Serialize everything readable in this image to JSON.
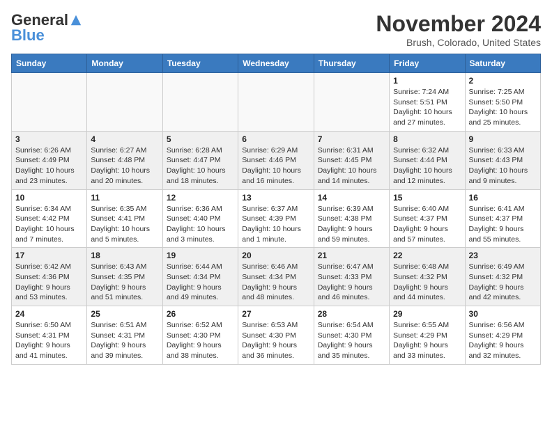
{
  "header": {
    "logo_general": "General",
    "logo_blue": "Blue",
    "month_title": "November 2024",
    "subtitle": "Brush, Colorado, United States"
  },
  "weekdays": [
    "Sunday",
    "Monday",
    "Tuesday",
    "Wednesday",
    "Thursday",
    "Friday",
    "Saturday"
  ],
  "weeks": [
    [
      {
        "day": "",
        "empty": true
      },
      {
        "day": "",
        "empty": true
      },
      {
        "day": "",
        "empty": true
      },
      {
        "day": "",
        "empty": true
      },
      {
        "day": "",
        "empty": true
      },
      {
        "day": "1",
        "sunrise": "Sunrise: 7:24 AM",
        "sunset": "Sunset: 5:51 PM",
        "daylight": "Daylight: 10 hours and 27 minutes."
      },
      {
        "day": "2",
        "sunrise": "Sunrise: 7:25 AM",
        "sunset": "Sunset: 5:50 PM",
        "daylight": "Daylight: 10 hours and 25 minutes."
      }
    ],
    [
      {
        "day": "3",
        "sunrise": "Sunrise: 6:26 AM",
        "sunset": "Sunset: 4:49 PM",
        "daylight": "Daylight: 10 hours and 23 minutes."
      },
      {
        "day": "4",
        "sunrise": "Sunrise: 6:27 AM",
        "sunset": "Sunset: 4:48 PM",
        "daylight": "Daylight: 10 hours and 20 minutes."
      },
      {
        "day": "5",
        "sunrise": "Sunrise: 6:28 AM",
        "sunset": "Sunset: 4:47 PM",
        "daylight": "Daylight: 10 hours and 18 minutes."
      },
      {
        "day": "6",
        "sunrise": "Sunrise: 6:29 AM",
        "sunset": "Sunset: 4:46 PM",
        "daylight": "Daylight: 10 hours and 16 minutes."
      },
      {
        "day": "7",
        "sunrise": "Sunrise: 6:31 AM",
        "sunset": "Sunset: 4:45 PM",
        "daylight": "Daylight: 10 hours and 14 minutes."
      },
      {
        "day": "8",
        "sunrise": "Sunrise: 6:32 AM",
        "sunset": "Sunset: 4:44 PM",
        "daylight": "Daylight: 10 hours and 12 minutes."
      },
      {
        "day": "9",
        "sunrise": "Sunrise: 6:33 AM",
        "sunset": "Sunset: 4:43 PM",
        "daylight": "Daylight: 10 hours and 9 minutes."
      }
    ],
    [
      {
        "day": "10",
        "sunrise": "Sunrise: 6:34 AM",
        "sunset": "Sunset: 4:42 PM",
        "daylight": "Daylight: 10 hours and 7 minutes."
      },
      {
        "day": "11",
        "sunrise": "Sunrise: 6:35 AM",
        "sunset": "Sunset: 4:41 PM",
        "daylight": "Daylight: 10 hours and 5 minutes."
      },
      {
        "day": "12",
        "sunrise": "Sunrise: 6:36 AM",
        "sunset": "Sunset: 4:40 PM",
        "daylight": "Daylight: 10 hours and 3 minutes."
      },
      {
        "day": "13",
        "sunrise": "Sunrise: 6:37 AM",
        "sunset": "Sunset: 4:39 PM",
        "daylight": "Daylight: 10 hours and 1 minute."
      },
      {
        "day": "14",
        "sunrise": "Sunrise: 6:39 AM",
        "sunset": "Sunset: 4:38 PM",
        "daylight": "Daylight: 9 hours and 59 minutes."
      },
      {
        "day": "15",
        "sunrise": "Sunrise: 6:40 AM",
        "sunset": "Sunset: 4:37 PM",
        "daylight": "Daylight: 9 hours and 57 minutes."
      },
      {
        "day": "16",
        "sunrise": "Sunrise: 6:41 AM",
        "sunset": "Sunset: 4:37 PM",
        "daylight": "Daylight: 9 hours and 55 minutes."
      }
    ],
    [
      {
        "day": "17",
        "sunrise": "Sunrise: 6:42 AM",
        "sunset": "Sunset: 4:36 PM",
        "daylight": "Daylight: 9 hours and 53 minutes."
      },
      {
        "day": "18",
        "sunrise": "Sunrise: 6:43 AM",
        "sunset": "Sunset: 4:35 PM",
        "daylight": "Daylight: 9 hours and 51 minutes."
      },
      {
        "day": "19",
        "sunrise": "Sunrise: 6:44 AM",
        "sunset": "Sunset: 4:34 PM",
        "daylight": "Daylight: 9 hours and 49 minutes."
      },
      {
        "day": "20",
        "sunrise": "Sunrise: 6:46 AM",
        "sunset": "Sunset: 4:34 PM",
        "daylight": "Daylight: 9 hours and 48 minutes."
      },
      {
        "day": "21",
        "sunrise": "Sunrise: 6:47 AM",
        "sunset": "Sunset: 4:33 PM",
        "daylight": "Daylight: 9 hours and 46 minutes."
      },
      {
        "day": "22",
        "sunrise": "Sunrise: 6:48 AM",
        "sunset": "Sunset: 4:32 PM",
        "daylight": "Daylight: 9 hours and 44 minutes."
      },
      {
        "day": "23",
        "sunrise": "Sunrise: 6:49 AM",
        "sunset": "Sunset: 4:32 PM",
        "daylight": "Daylight: 9 hours and 42 minutes."
      }
    ],
    [
      {
        "day": "24",
        "sunrise": "Sunrise: 6:50 AM",
        "sunset": "Sunset: 4:31 PM",
        "daylight": "Daylight: 9 hours and 41 minutes."
      },
      {
        "day": "25",
        "sunrise": "Sunrise: 6:51 AM",
        "sunset": "Sunset: 4:31 PM",
        "daylight": "Daylight: 9 hours and 39 minutes."
      },
      {
        "day": "26",
        "sunrise": "Sunrise: 6:52 AM",
        "sunset": "Sunset: 4:30 PM",
        "daylight": "Daylight: 9 hours and 38 minutes."
      },
      {
        "day": "27",
        "sunrise": "Sunrise: 6:53 AM",
        "sunset": "Sunset: 4:30 PM",
        "daylight": "Daylight: 9 hours and 36 minutes."
      },
      {
        "day": "28",
        "sunrise": "Sunrise: 6:54 AM",
        "sunset": "Sunset: 4:30 PM",
        "daylight": "Daylight: 9 hours and 35 minutes."
      },
      {
        "day": "29",
        "sunrise": "Sunrise: 6:55 AM",
        "sunset": "Sunset: 4:29 PM",
        "daylight": "Daylight: 9 hours and 33 minutes."
      },
      {
        "day": "30",
        "sunrise": "Sunrise: 6:56 AM",
        "sunset": "Sunset: 4:29 PM",
        "daylight": "Daylight: 9 hours and 32 minutes."
      }
    ]
  ]
}
